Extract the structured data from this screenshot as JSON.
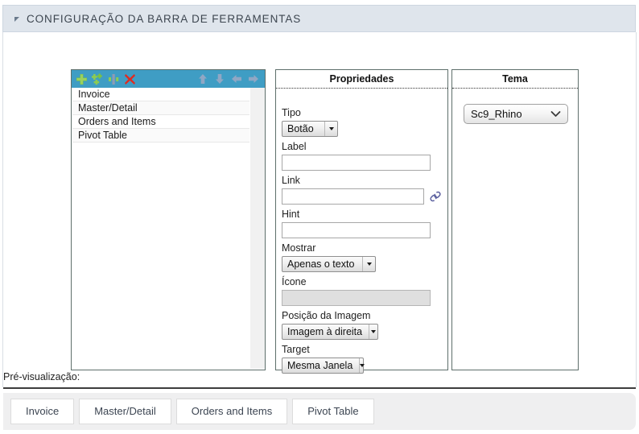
{
  "header": {
    "title": "CONFIGURAÇÃO DA BARRA DE FERRAMENTAS",
    "collapse_icon": "triangle-collapse-icon",
    "background": "#dfe5ec"
  },
  "list_panel": {
    "toolbar": {
      "background": "#3f9dc4",
      "buttons": [
        {
          "name": "add-item-button",
          "icon": "plus-green-icon",
          "enabled": true
        },
        {
          "name": "add-group-button",
          "icon": "plus-multiple-green-icon",
          "enabled": true
        },
        {
          "name": "add-separator-button",
          "icon": "separator-icon",
          "enabled": true
        },
        {
          "name": "delete-item-button",
          "icon": "close-red-x-icon",
          "enabled": true
        },
        {
          "name": "move-up-button",
          "icon": "arrow-up-icon",
          "enabled": false
        },
        {
          "name": "move-down-button",
          "icon": "arrow-down-icon",
          "enabled": false
        },
        {
          "name": "move-left-button",
          "icon": "arrow-left-icon",
          "enabled": false
        },
        {
          "name": "move-right-button",
          "icon": "arrow-right-icon",
          "enabled": false
        }
      ]
    },
    "items": [
      {
        "label": "Invoice"
      },
      {
        "label": "Master/Detail"
      },
      {
        "label": "Orders and Items"
      },
      {
        "label": "Pivot Table"
      }
    ]
  },
  "properties_panel": {
    "title": "Propriedades",
    "fields": {
      "tipo": {
        "label": "Tipo",
        "value": "Botão"
      },
      "label": {
        "label": "Label",
        "value": ""
      },
      "link": {
        "label": "Link",
        "value": "",
        "icon": "chain-link-icon"
      },
      "hint": {
        "label": "Hint",
        "value": ""
      },
      "mostrar": {
        "label": "Mostrar",
        "value": "Apenas o texto"
      },
      "icone": {
        "label": "Ícone",
        "value": "",
        "disabled": true
      },
      "posicao_da_imagem": {
        "label": "Posição da Imagem",
        "value": "Imagem à direita"
      },
      "target": {
        "label": "Target",
        "value": "Mesma Janela"
      }
    }
  },
  "theme_panel": {
    "title": "Tema",
    "theme_select": {
      "value": "Sc9_Rhino",
      "icon": "chevron-down-icon"
    }
  },
  "preview": {
    "label": "Pré-visualização:",
    "buttons": [
      {
        "label": "Invoice"
      },
      {
        "label": "Master/Detail"
      },
      {
        "label": "Orders and Items"
      },
      {
        "label": "Pivot Table"
      }
    ]
  }
}
